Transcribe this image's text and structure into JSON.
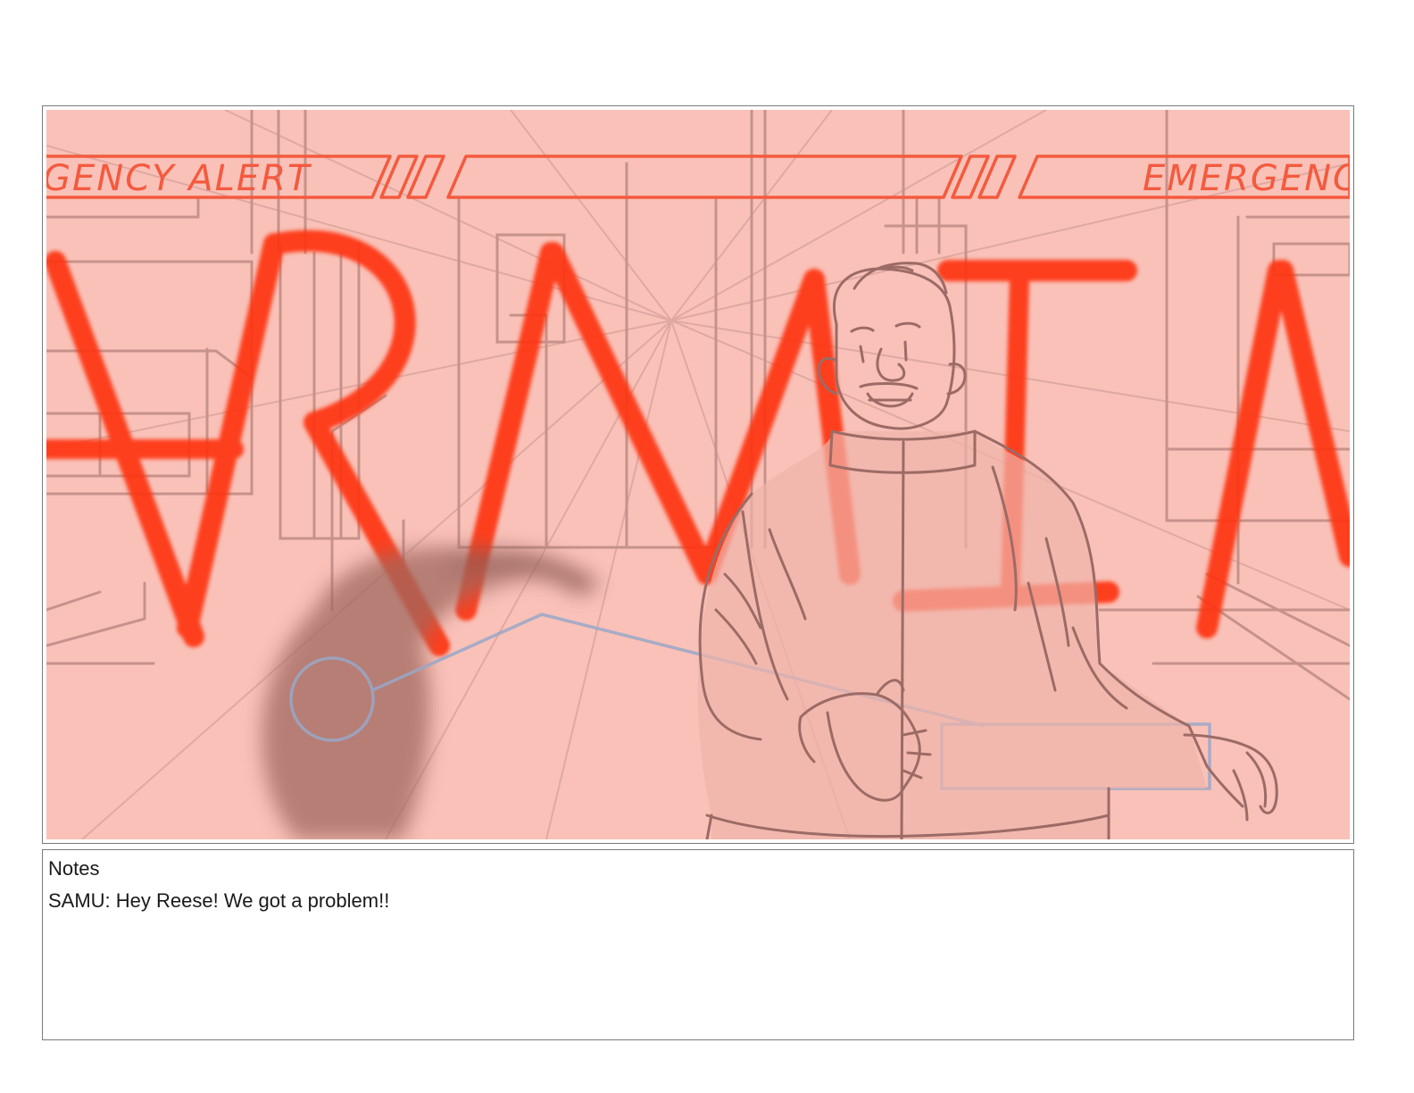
{
  "panel": {
    "banner_left": "GENCY ALERT",
    "banner_right": "EMERGENC",
    "alarm_text": "ARMA"
  },
  "notes": {
    "heading": "Notes",
    "dialogue": "SAMU: Hey Reese! We got a problem!!"
  },
  "colors": {
    "background_tint": "#f9c1b8",
    "alarm_red": "#ff2a00",
    "sketch_line": "#9c6b66",
    "motion_path": "#9aa7c8"
  }
}
